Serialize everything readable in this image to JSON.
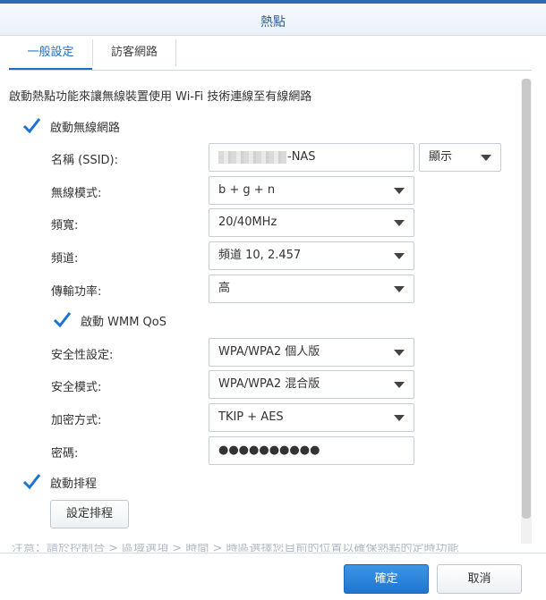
{
  "window": {
    "title": "熱點"
  },
  "tabs": [
    {
      "label": "一般設定"
    },
    {
      "label": "訪客網路"
    }
  ],
  "intro_text": "啟動熱點功能來讓無線裝置使用 Wi-Fi 技術連線至有線網路",
  "enable_wireless": {
    "label": "啟動無線網路",
    "checked": true
  },
  "fields": {
    "ssid": {
      "label": "名稱 (SSID):",
      "value": "-NAS"
    },
    "ssid_visibility": {
      "value": "顯示"
    },
    "wireless_mode": {
      "label": "無線模式:",
      "value": "b + g + n"
    },
    "bandwidth": {
      "label": "頻寬:",
      "value": "20/40MHz"
    },
    "channel": {
      "label": "頻道:",
      "value": "頻道 10, 2.457"
    },
    "tx_power": {
      "label": "傳輸功率:",
      "value": "高"
    },
    "security_level": {
      "label": "安全性設定:",
      "value": "WPA/WPA2 個人版"
    },
    "security_mode": {
      "label": "安全模式:",
      "value": "WPA/WPA2 混合版"
    },
    "encryption": {
      "label": "加密方式:",
      "value": "TKIP + AES"
    },
    "password": {
      "label": "密碼:",
      "value": "●●●●●●●●●●"
    }
  },
  "enable_wmm": {
    "label": "啟動 WMM QoS",
    "checked": true
  },
  "enable_schedule": {
    "label": "啟動排程",
    "checked": true
  },
  "schedule_button": {
    "label": "設定排程"
  },
  "note_text": "注意：請於控制台 > 區域選項 > 時間 > 時區選擇您目前的位置以確保熱點的定時功能",
  "footer": {
    "ok_label": "確定",
    "cancel_label": "取消"
  },
  "colors": {
    "accent": "#1b6fc4",
    "primary_button": "#2b84da",
    "title": "#2c5f9b"
  }
}
